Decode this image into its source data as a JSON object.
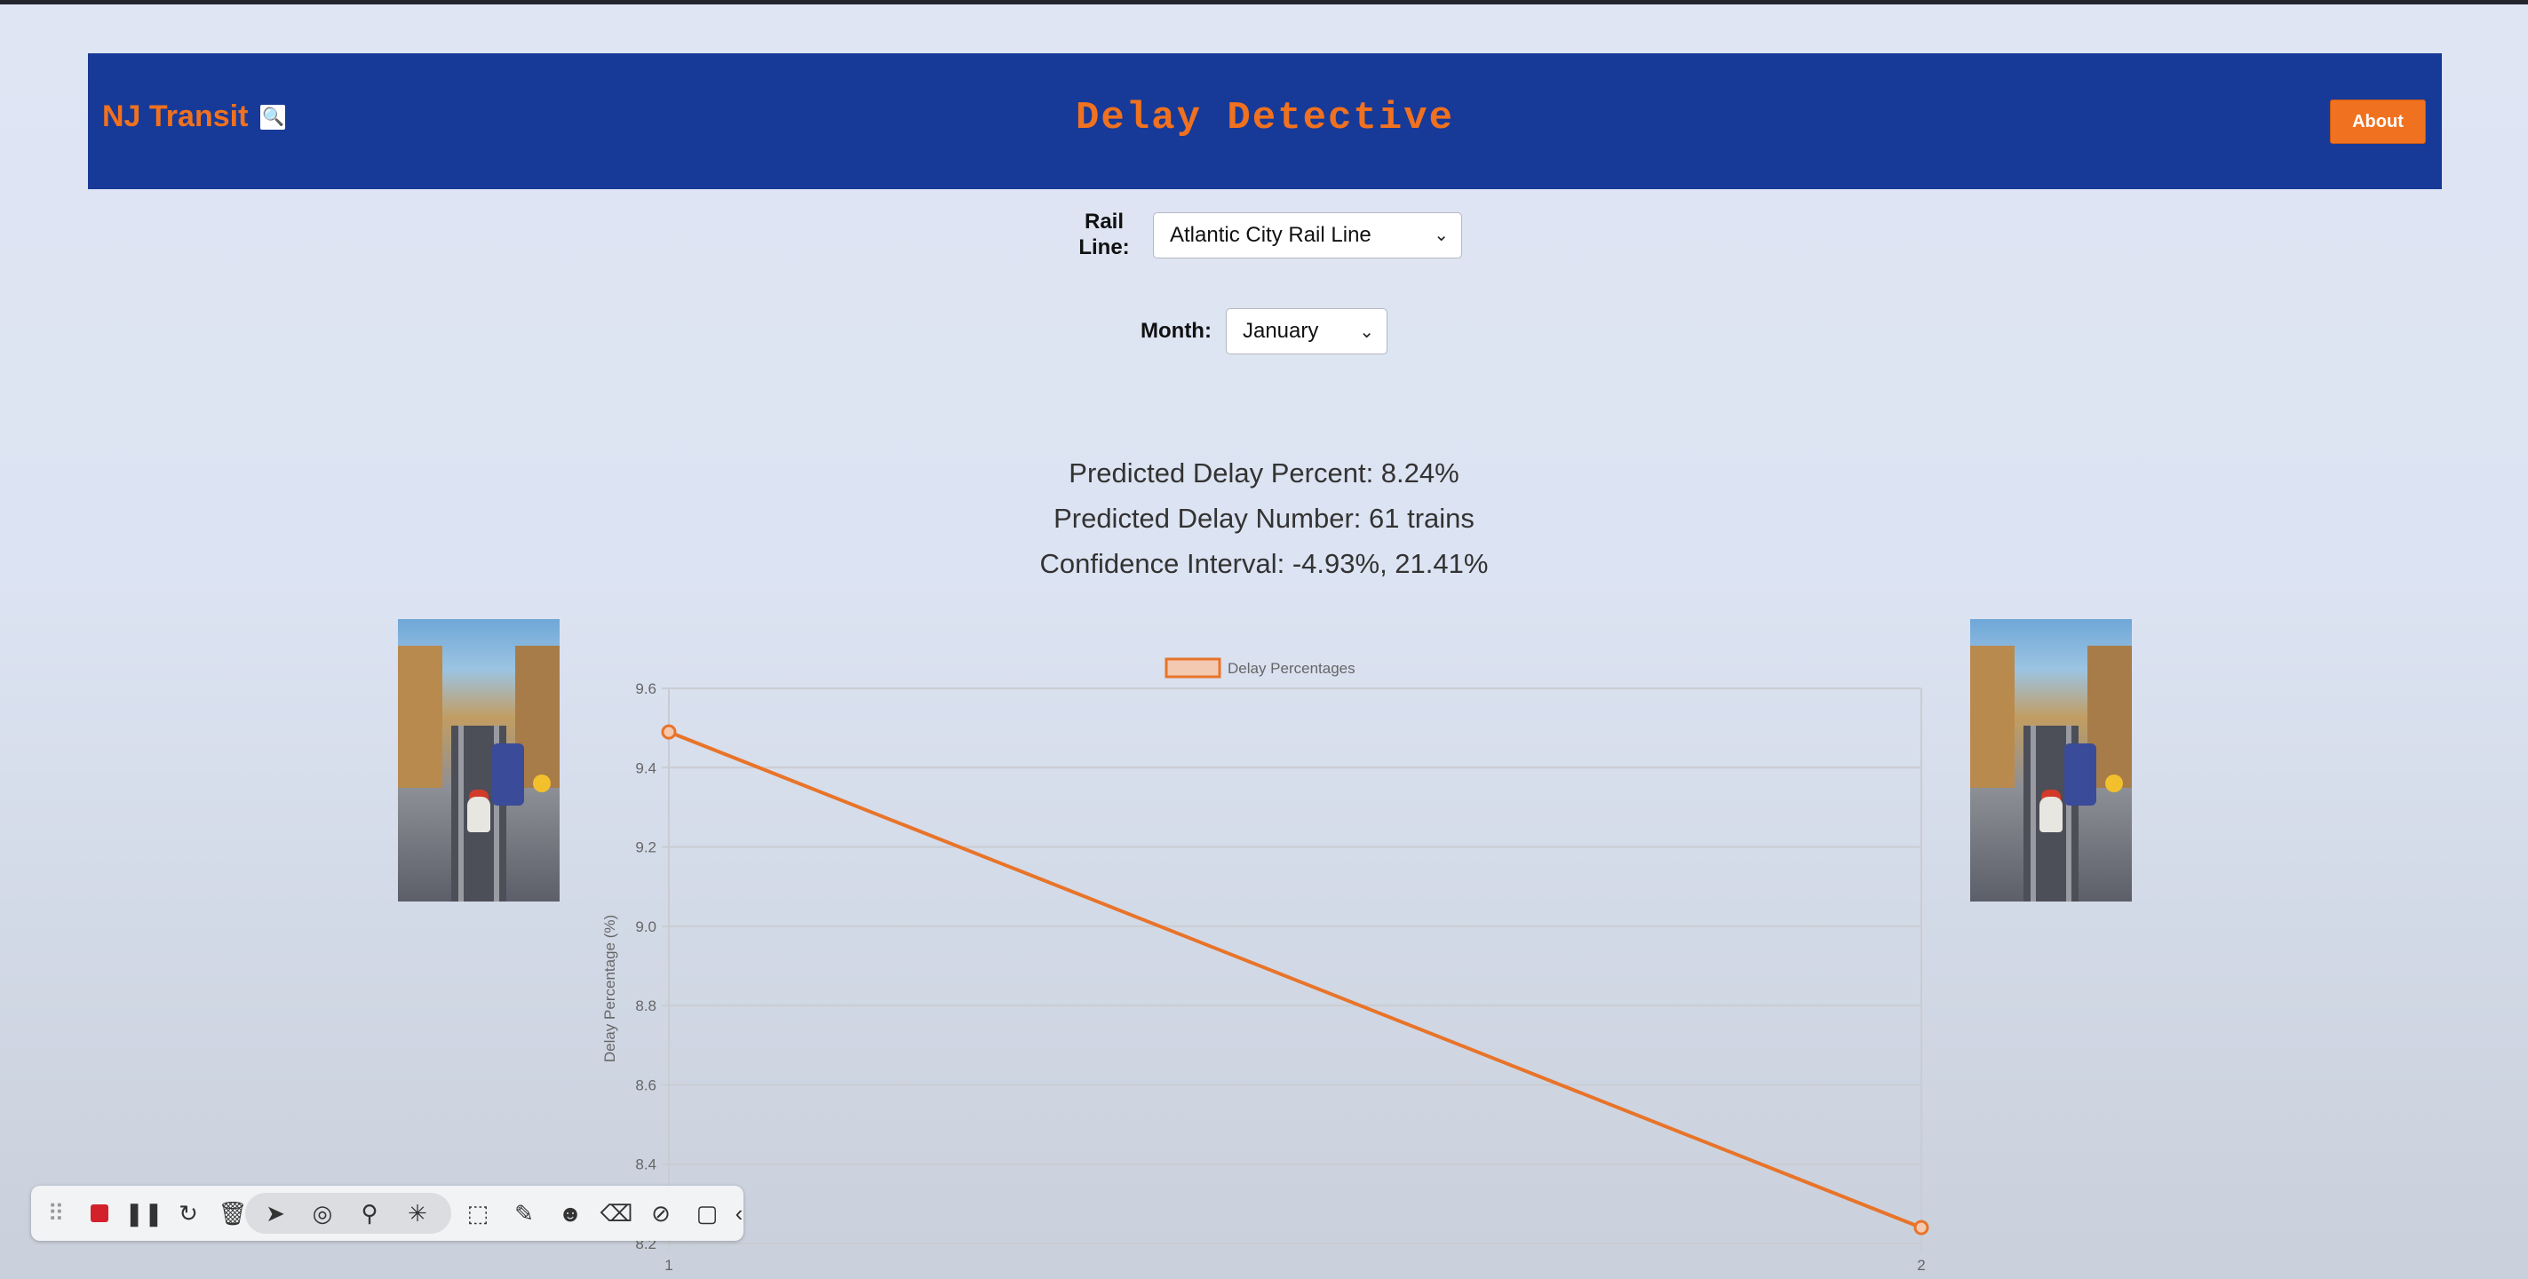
{
  "header": {
    "brand": "NJ Transit",
    "brand_icon": "magnifier-icon",
    "title": "Delay Detective",
    "about_label": "About",
    "colors": {
      "bar": "#173a98",
      "accent": "#f0711f"
    }
  },
  "filters": {
    "rail_line_label": "Rail Line:",
    "rail_line_value": "Atlantic City Rail Line",
    "month_label": "Month:",
    "month_value": "January"
  },
  "results": {
    "percent": "Predicted Delay Percent: 8.24%",
    "number": "Predicted Delay Number: 61 trains",
    "interval": "Confidence Interval: -4.93%, 21.41%"
  },
  "chart_data": {
    "type": "line",
    "title": "",
    "xlabel": "",
    "ylabel": "Delay Percentage (%)",
    "legend": "top-center",
    "grid": true,
    "x": [
      1,
      2
    ],
    "x_ticks": [
      "1",
      "2"
    ],
    "y_ticks": [
      "8.2",
      "8.4",
      "8.6",
      "8.8",
      "9.0",
      "9.2",
      "9.4",
      "9.6"
    ],
    "ylim": [
      8.2,
      9.6
    ],
    "series": [
      {
        "name": "Delay Percentages",
        "values": [
          9.49,
          8.24
        ],
        "color": "#e8742a"
      }
    ]
  },
  "toolbar": {
    "icons": [
      "drag-handle-icon",
      "record-stop-icon",
      "pause-icon",
      "restart-icon",
      "trash-icon",
      "pointer-icon",
      "spotlight-icon",
      "zoom-cursor-icon",
      "click-effect-icon",
      "select-area-icon",
      "pen-icon",
      "emoji-icon",
      "eraser-icon",
      "clear-annotations-icon",
      "camera-icon",
      "collapse-icon"
    ]
  }
}
